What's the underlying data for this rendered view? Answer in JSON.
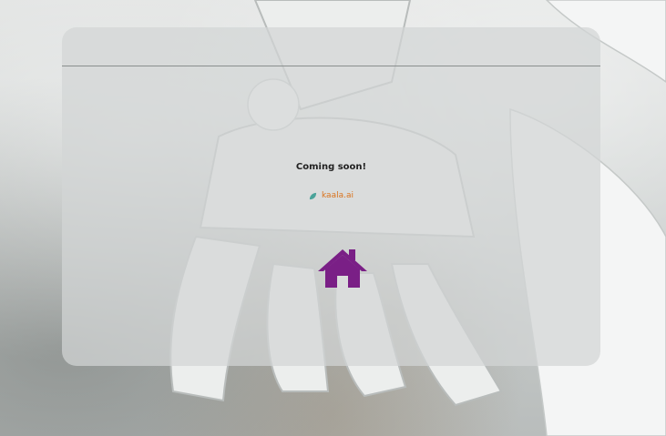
{
  "message": "Coming soon!",
  "brand": {
    "name": "kaala.ai",
    "icon": "leaf-icon",
    "color": "#d9731d"
  },
  "home_link": {
    "icon": "home-icon",
    "color": "#7a1f86"
  }
}
